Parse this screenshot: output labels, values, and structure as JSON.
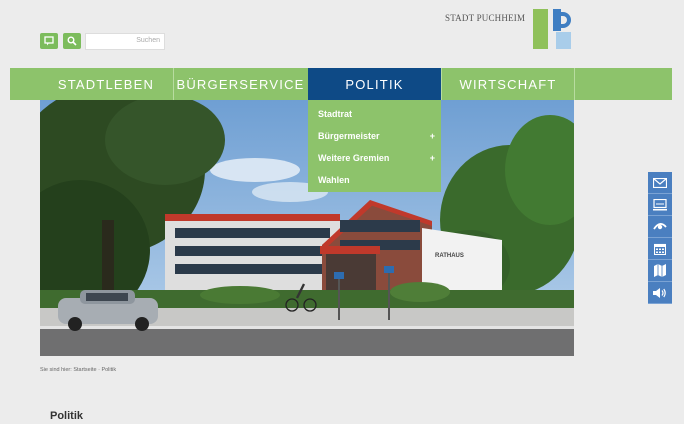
{
  "header": {
    "city_name": "STADT PUCHHEIM",
    "search_placeholder": "Suchen",
    "icons": [
      "bookmark-icon",
      "search-icon"
    ],
    "logo_colors": {
      "green": "#8fc15a",
      "blue": "#3f7ec2",
      "light_blue": "#a9cdea"
    }
  },
  "nav": {
    "items": [
      {
        "label": "STADTLEBEN",
        "active": false
      },
      {
        "label": "BÜRGERSERVICE",
        "active": false
      },
      {
        "label": "POLITIK",
        "active": true
      },
      {
        "label": "WIRTSCHAFT",
        "active": false
      }
    ],
    "bar_color": "#8dc36b",
    "active_color": "#0e4a86"
  },
  "dropdown": {
    "items": [
      {
        "label": "Stadtrat",
        "expandable": false
      },
      {
        "label": "Bürgermeister",
        "expandable": true,
        "marker": "+"
      },
      {
        "label": "Weitere Gremien",
        "expandable": true,
        "marker": "+"
      },
      {
        "label": "Wahlen",
        "expandable": false
      }
    ]
  },
  "hero": {
    "sign_text": "RATHAUS"
  },
  "sidebar": {
    "icons": [
      "mail-icon",
      "monitor-icon",
      "eye-icon",
      "calendar-icon",
      "map-icon",
      "speaker-icon"
    ],
    "color": "#4a7fc0"
  },
  "breadcrumb": {
    "label": "Sie sind hier:",
    "items": [
      "Startseite",
      "Politik"
    ],
    "text": "Sie sind hier: Startseite · Politik"
  },
  "page": {
    "title": "Politik"
  }
}
